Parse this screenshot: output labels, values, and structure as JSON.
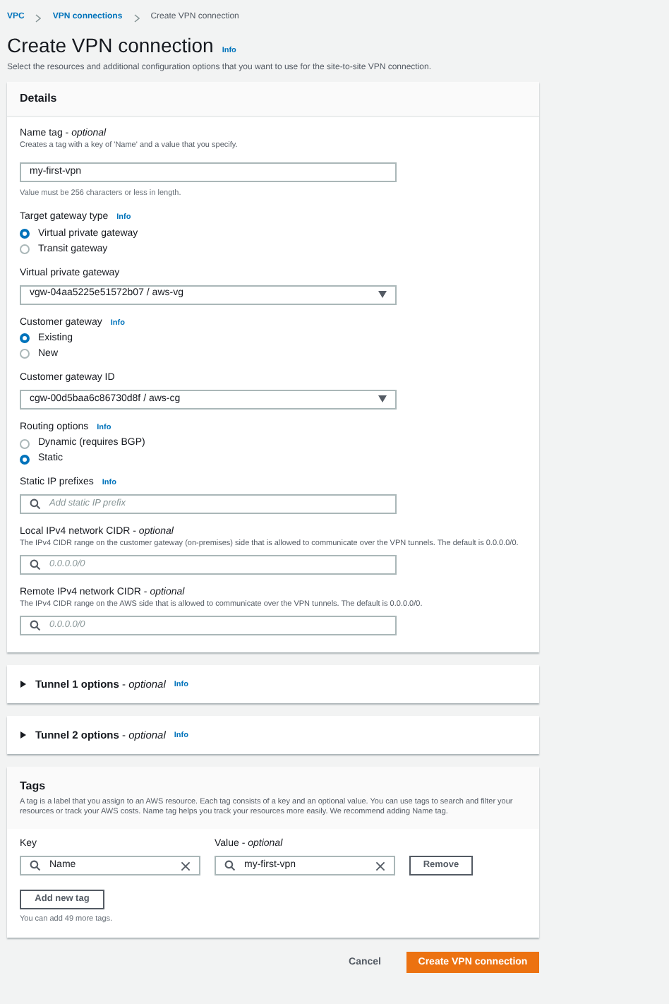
{
  "breadcrumbs": [
    {
      "label": "VPC",
      "link": true
    },
    {
      "label": "VPN connections",
      "link": true
    },
    {
      "label": "Create VPN connection",
      "link": false
    }
  ],
  "title": "Create VPN connection",
  "title_info": "Info",
  "description": "Select the resources and additional configuration options that you want to use for the site-to-site VPN connection.",
  "details": {
    "heading": "Details",
    "fields": [
      {
        "kind": "text",
        "label": "Name tag - *optional*",
        "help": "Creates a tag with a key of 'Name' and a value that you specify.",
        "value": "my-first-vpn",
        "constraint": "Value must be 256 characters or less in length."
      },
      {
        "kind": "radio",
        "label": "Target gateway type",
        "info": "Info",
        "options": [
          {
            "label": "Virtual private gateway",
            "selected": true
          },
          {
            "label": "Transit gateway",
            "selected": false
          }
        ]
      },
      {
        "kind": "select",
        "label": "Virtual private gateway",
        "value": "vgw-04aa5225e51572b07 / aws-vg"
      },
      {
        "kind": "radio",
        "label": "Customer gateway",
        "info": "Info",
        "options": [
          {
            "label": "Existing",
            "selected": true
          },
          {
            "label": "New",
            "selected": false
          }
        ]
      },
      {
        "kind": "select",
        "label": "Customer gateway ID",
        "value": "cgw-00d5baa6c86730d8f / aws-cg"
      },
      {
        "kind": "radio",
        "label": "Routing options",
        "info": "Info",
        "options": [
          {
            "label": "Dynamic (requires BGP)",
            "selected": false
          },
          {
            "label": "Static",
            "selected": true
          }
        ]
      },
      {
        "kind": "search",
        "label": "Static IP prefixes",
        "info": "Info",
        "placeholder": "Add static IP prefix"
      },
      {
        "kind": "search",
        "label": "Local IPv4 network CIDR - *optional*",
        "help": "The IPv4 CIDR range on the customer gateway (on-premises) side that is allowed to communicate over the VPN tunnels. The default is 0.0.0.0/0.",
        "placeholder": "0.0.0.0/0"
      },
      {
        "kind": "search",
        "label": "Remote IPv4 network CIDR - *optional*",
        "help": "The IPv4 CIDR range on the AWS side that is allowed to communicate over the VPN tunnels. The default is 0.0.0.0/0.",
        "placeholder": "0.0.0.0/0"
      }
    ]
  },
  "tunnels": [
    {
      "title": "**Tunnel 1 options** - *optional*",
      "info": "Info",
      "expanded": false
    },
    {
      "title": "**Tunnel 2 options** - *optional*",
      "info": "Info",
      "expanded": false
    }
  ],
  "tags": {
    "heading": "Tags",
    "description": "A tag is a label that you assign to an AWS resource. Each tag consists of a key and an optional value. You can use tags to search and filter your resources or track your AWS costs. Name tag helps you track your resources more easily. We recommend adding Name tag.",
    "key_label": "Key",
    "value_label": "Value - *optional*",
    "rows": [
      {
        "key": "Name",
        "value": "my-first-vpn",
        "remove": "Remove"
      }
    ],
    "add_button": "Add new tag",
    "limit": "You can add 49 more tags."
  },
  "footer": {
    "cancel": "Cancel",
    "submit": "Create VPN connection"
  }
}
